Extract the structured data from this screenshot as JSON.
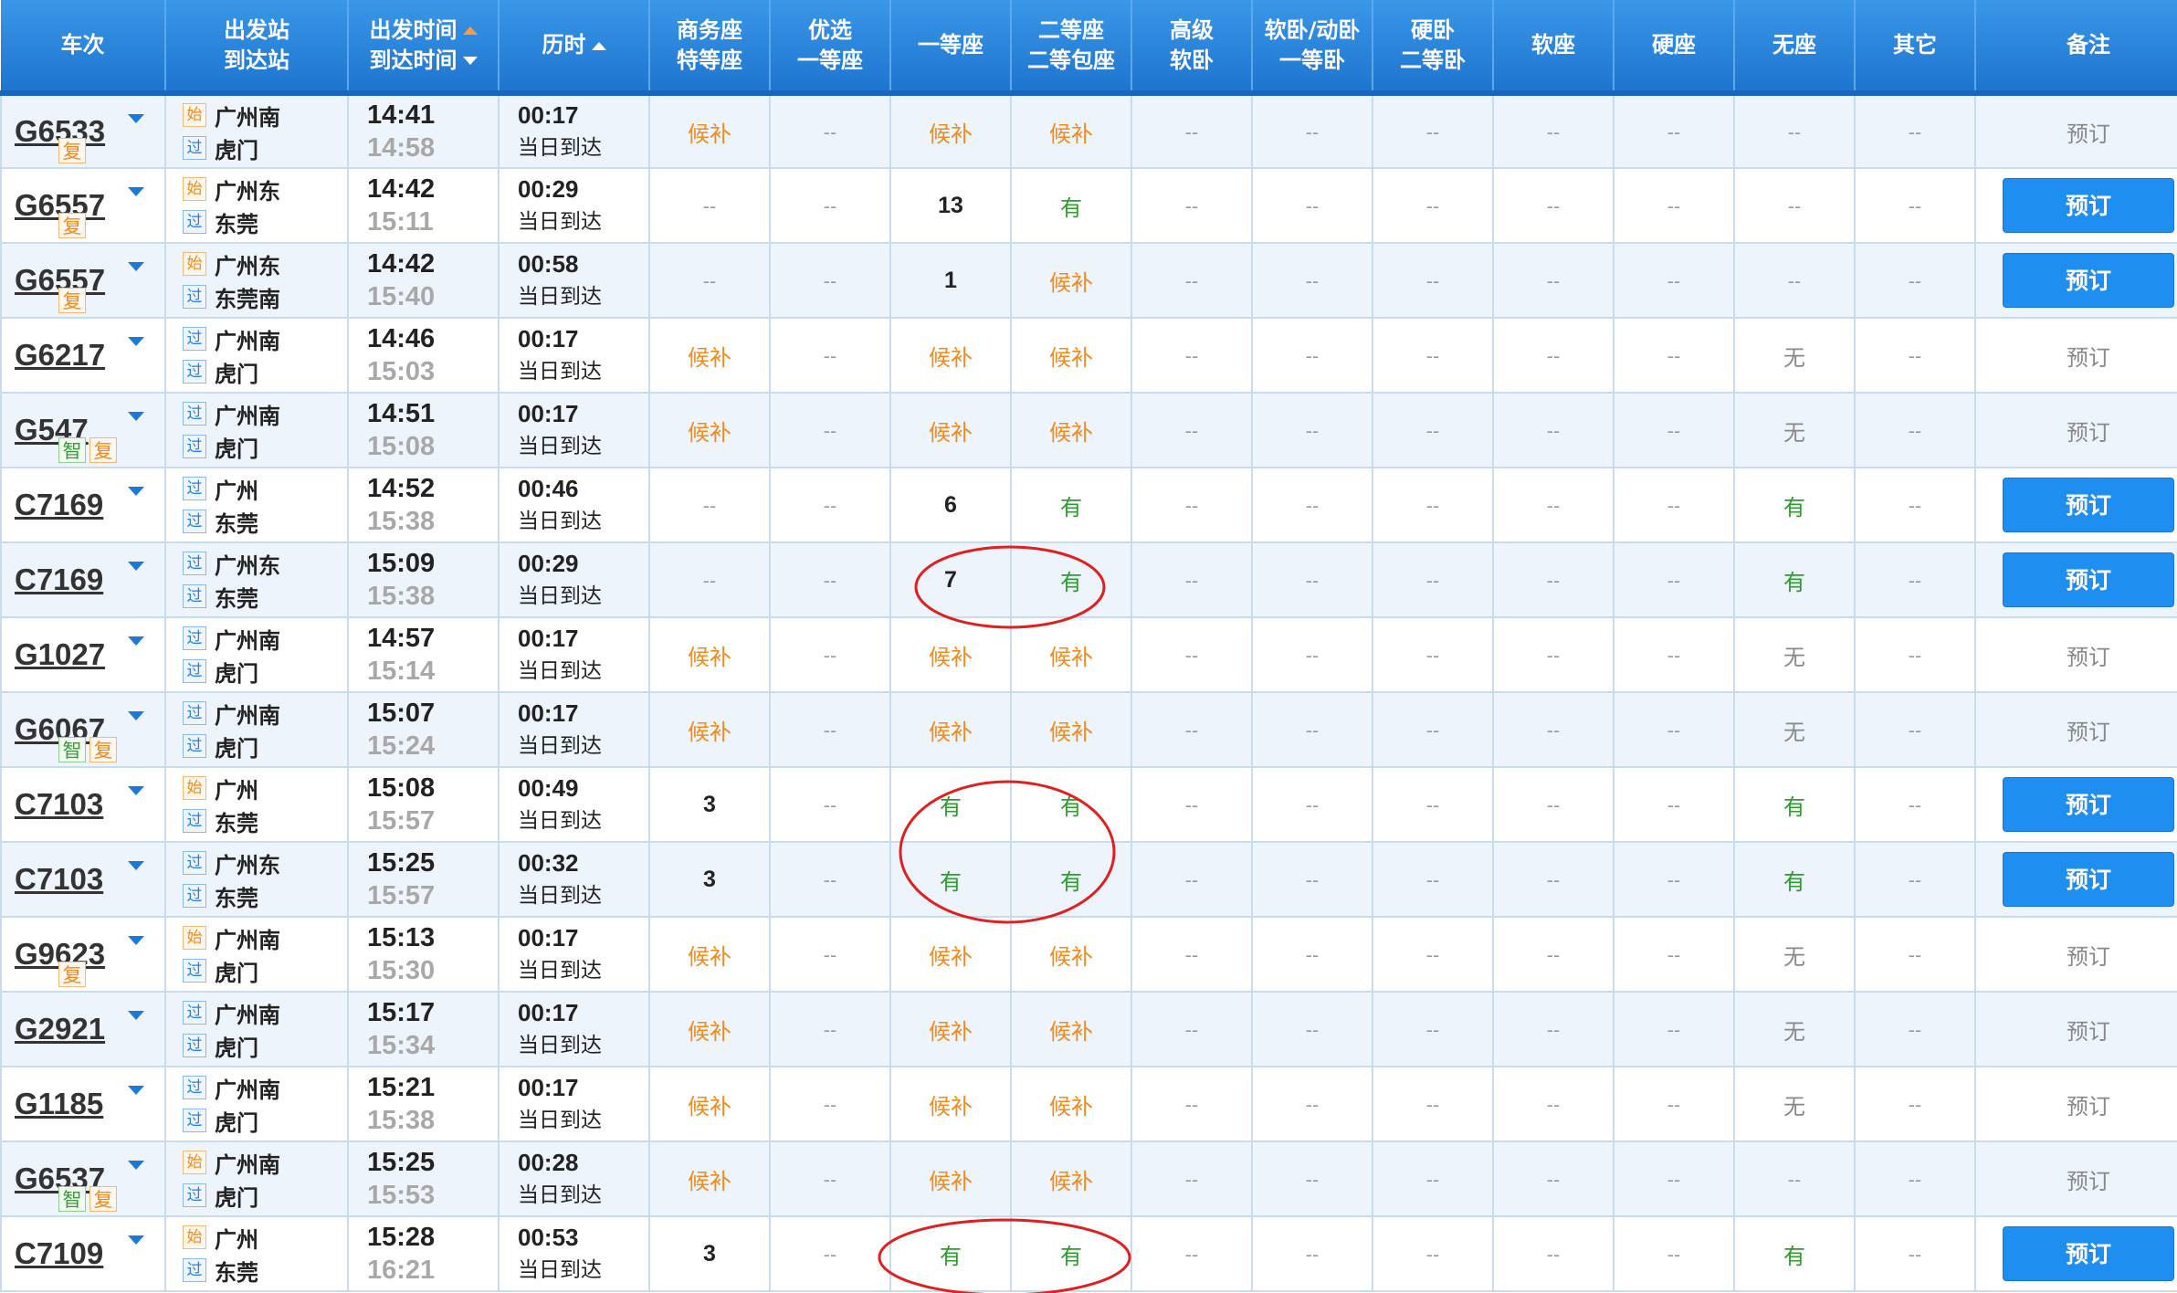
{
  "header": {
    "train": "车次",
    "station_dep": "出发站",
    "station_arr": "到达站",
    "time_dep": "出发时间",
    "time_arr": "到达时间",
    "duration": "历时",
    "seat_shangwu_1": "商务座",
    "seat_shangwu_2": "特等座",
    "seat_youxuan_1": "优选",
    "seat_youxuan_2": "一等座",
    "seat_yideng": "一等座",
    "seat_erdeng_1": "二等座",
    "seat_erdeng_2": "二等包座",
    "seat_gaoji_1": "高级",
    "seat_gaoji_2": "软卧",
    "seat_ruanwo_1": "软卧/动卧",
    "seat_ruanwo_2": "一等卧",
    "seat_yingwo_1": "硬卧",
    "seat_yingwo_2": "二等卧",
    "seat_ruanzuo": "软座",
    "seat_yingzuo": "硬座",
    "seat_wuzuo": "无座",
    "seat_qita": "其它",
    "note": "备注"
  },
  "legend_tags": {
    "shi": "始",
    "guo": "过",
    "fu": "复",
    "zhi": "智"
  },
  "rows": [
    {
      "train": "G6533",
      "badges": [
        "复"
      ],
      "from_tag": "始",
      "from": "广州南",
      "to_tag": "过",
      "to": "虎门",
      "dep": "14:41",
      "arr": "14:58",
      "dur": "00:17",
      "dur_note": "当日到达",
      "seats": [
        "候补",
        "--",
        "候补",
        "候补",
        "--",
        "--",
        "--",
        "--",
        "--",
        "--",
        "--"
      ],
      "book": "预订",
      "bookable": false
    },
    {
      "train": "G6557",
      "badges": [
        "复"
      ],
      "from_tag": "始",
      "from": "广州东",
      "to_tag": "过",
      "to": "东莞",
      "dep": "14:42",
      "arr": "15:11",
      "dur": "00:29",
      "dur_note": "当日到达",
      "seats": [
        "--",
        "--",
        "13",
        "有",
        "--",
        "--",
        "--",
        "--",
        "--",
        "--",
        "--"
      ],
      "book": "预订",
      "bookable": true
    },
    {
      "train": "G6557",
      "badges": [
        "复"
      ],
      "from_tag": "始",
      "from": "广州东",
      "to_tag": "过",
      "to": "东莞南",
      "dep": "14:42",
      "arr": "15:40",
      "dur": "00:58",
      "dur_note": "当日到达",
      "seats": [
        "--",
        "--",
        "1",
        "候补",
        "--",
        "--",
        "--",
        "--",
        "--",
        "--",
        "--"
      ],
      "book": "预订",
      "bookable": true
    },
    {
      "train": "G6217",
      "badges": [],
      "from_tag": "过",
      "from": "广州南",
      "to_tag": "过",
      "to": "虎门",
      "dep": "14:46",
      "arr": "15:03",
      "dur": "00:17",
      "dur_note": "当日到达",
      "seats": [
        "候补",
        "--",
        "候补",
        "候补",
        "--",
        "--",
        "--",
        "--",
        "--",
        "无",
        "--"
      ],
      "book": "预订",
      "bookable": false
    },
    {
      "train": "G547",
      "badges": [
        "智",
        "复"
      ],
      "from_tag": "过",
      "from": "广州南",
      "to_tag": "过",
      "to": "虎门",
      "dep": "14:51",
      "arr": "15:08",
      "dur": "00:17",
      "dur_note": "当日到达",
      "seats": [
        "候补",
        "--",
        "候补",
        "候补",
        "--",
        "--",
        "--",
        "--",
        "--",
        "无",
        "--"
      ],
      "book": "预订",
      "bookable": false
    },
    {
      "train": "C7169",
      "badges": [],
      "from_tag": "过",
      "from": "广州",
      "to_tag": "过",
      "to": "东莞",
      "dep": "14:52",
      "arr": "15:38",
      "dur": "00:46",
      "dur_note": "当日到达",
      "seats": [
        "--",
        "--",
        "6",
        "有",
        "--",
        "--",
        "--",
        "--",
        "--",
        "有",
        "--"
      ],
      "book": "预订",
      "bookable": true
    },
    {
      "train": "C7169",
      "badges": [],
      "from_tag": "过",
      "from": "广州东",
      "to_tag": "过",
      "to": "东莞",
      "dep": "15:09",
      "arr": "15:38",
      "dur": "00:29",
      "dur_note": "当日到达",
      "seats": [
        "--",
        "--",
        "7",
        "有",
        "--",
        "--",
        "--",
        "--",
        "--",
        "有",
        "--"
      ],
      "book": "预订",
      "bookable": true
    },
    {
      "train": "G1027",
      "badges": [],
      "from_tag": "过",
      "from": "广州南",
      "to_tag": "过",
      "to": "虎门",
      "dep": "14:57",
      "arr": "15:14",
      "dur": "00:17",
      "dur_note": "当日到达",
      "seats": [
        "候补",
        "--",
        "候补",
        "候补",
        "--",
        "--",
        "--",
        "--",
        "--",
        "无",
        "--"
      ],
      "book": "预订",
      "bookable": false
    },
    {
      "train": "G6067",
      "badges": [
        "智",
        "复"
      ],
      "from_tag": "过",
      "from": "广州南",
      "to_tag": "过",
      "to": "虎门",
      "dep": "15:07",
      "arr": "15:24",
      "dur": "00:17",
      "dur_note": "当日到达",
      "seats": [
        "候补",
        "--",
        "候补",
        "候补",
        "--",
        "--",
        "--",
        "--",
        "--",
        "无",
        "--"
      ],
      "book": "预订",
      "bookable": false
    },
    {
      "train": "C7103",
      "badges": [],
      "from_tag": "始",
      "from": "广州",
      "to_tag": "过",
      "to": "东莞",
      "dep": "15:08",
      "arr": "15:57",
      "dur": "00:49",
      "dur_note": "当日到达",
      "seats": [
        "3",
        "--",
        "有",
        "有",
        "--",
        "--",
        "--",
        "--",
        "--",
        "有",
        "--"
      ],
      "book": "预订",
      "bookable": true
    },
    {
      "train": "C7103",
      "badges": [],
      "from_tag": "过",
      "from": "广州东",
      "to_tag": "过",
      "to": "东莞",
      "dep": "15:25",
      "arr": "15:57",
      "dur": "00:32",
      "dur_note": "当日到达",
      "seats": [
        "3",
        "--",
        "有",
        "有",
        "--",
        "--",
        "--",
        "--",
        "--",
        "有",
        "--"
      ],
      "book": "预订",
      "bookable": true
    },
    {
      "train": "G9623",
      "badges": [
        "复"
      ],
      "from_tag": "始",
      "from": "广州南",
      "to_tag": "过",
      "to": "虎门",
      "dep": "15:13",
      "arr": "15:30",
      "dur": "00:17",
      "dur_note": "当日到达",
      "seats": [
        "候补",
        "--",
        "候补",
        "候补",
        "--",
        "--",
        "--",
        "--",
        "--",
        "无",
        "--"
      ],
      "book": "预订",
      "bookable": false
    },
    {
      "train": "G2921",
      "badges": [],
      "from_tag": "过",
      "from": "广州南",
      "to_tag": "过",
      "to": "虎门",
      "dep": "15:17",
      "arr": "15:34",
      "dur": "00:17",
      "dur_note": "当日到达",
      "seats": [
        "候补",
        "--",
        "候补",
        "候补",
        "--",
        "--",
        "--",
        "--",
        "--",
        "无",
        "--"
      ],
      "book": "预订",
      "bookable": false
    },
    {
      "train": "G1185",
      "badges": [],
      "from_tag": "过",
      "from": "广州南",
      "to_tag": "过",
      "to": "虎门",
      "dep": "15:21",
      "arr": "15:38",
      "dur": "00:17",
      "dur_note": "当日到达",
      "seats": [
        "候补",
        "--",
        "候补",
        "候补",
        "--",
        "--",
        "--",
        "--",
        "--",
        "无",
        "--"
      ],
      "book": "预订",
      "bookable": false
    },
    {
      "train": "G6537",
      "badges": [
        "智",
        "复"
      ],
      "from_tag": "始",
      "from": "广州南",
      "to_tag": "过",
      "to": "虎门",
      "dep": "15:25",
      "arr": "15:53",
      "dur": "00:28",
      "dur_note": "当日到达",
      "seats": [
        "候补",
        "--",
        "候补",
        "候补",
        "--",
        "--",
        "--",
        "--",
        "--",
        "--",
        "--"
      ],
      "book": "预订",
      "bookable": false
    },
    {
      "train": "C7109",
      "badges": [],
      "from_tag": "始",
      "from": "广州",
      "to_tag": "过",
      "to": "东莞",
      "dep": "15:28",
      "arr": "16:21",
      "dur": "00:53",
      "dur_note": "当日到达",
      "seats": [
        "3",
        "--",
        "有",
        "有",
        "--",
        "--",
        "--",
        "--",
        "--",
        "有",
        "--"
      ],
      "book": "预订",
      "bookable": true
    }
  ],
  "colors": {
    "header_blue": "#1e75cf",
    "book_button": "#1e8ef0",
    "houbu_orange": "#f08a1c",
    "you_green": "#2f9a2f",
    "annotation_red": "#e02020"
  }
}
